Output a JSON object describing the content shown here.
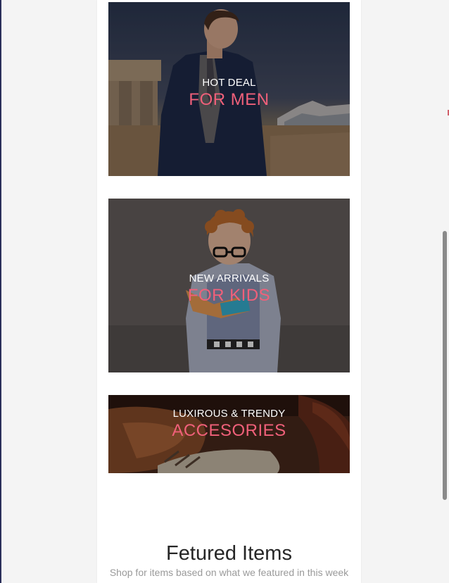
{
  "banners": [
    {
      "kicker": "HOT DEAL",
      "headline": "FOR MEN",
      "image": "man-in-navy-suit-photo"
    },
    {
      "kicker": "NEW ARRIVALS",
      "headline": "FOR KIDS",
      "image": "boy-with-glasses-photo"
    },
    {
      "kicker": "LUXIROUS & TRENDY",
      "headline": "ACCESORIES",
      "image": "leather-shoes-photo"
    }
  ],
  "featured": {
    "title": "Fetured Items",
    "subtitle": "Shop for items based on what we featured in this week"
  },
  "colors": {
    "accent": "#f0607a",
    "caption_text": "#ffffff",
    "title_text": "#262626",
    "subtitle_text": "#9a9a9a"
  }
}
